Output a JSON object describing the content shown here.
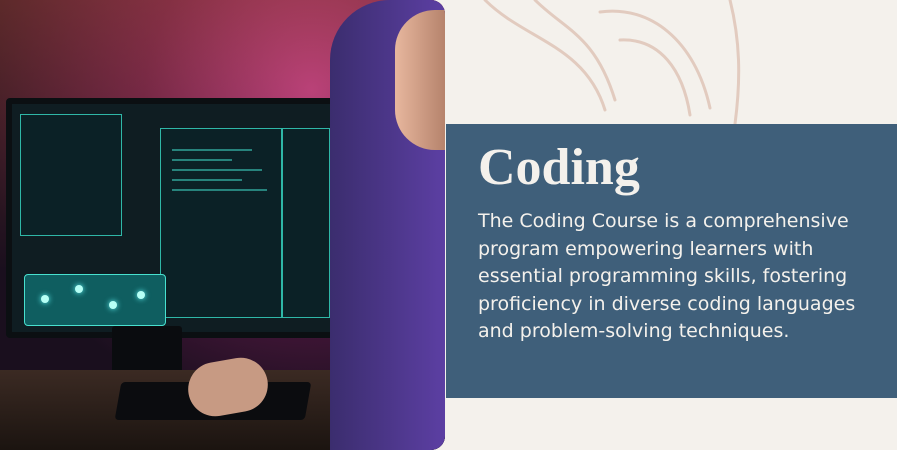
{
  "card": {
    "title": "Coding",
    "description": "The Coding Course is a comprehensive program empowering learners with essential programming skills, fostering proficiency in diverse coding languages and problem-solving techniques."
  },
  "colors": {
    "background": "#f4f1ec",
    "text_panel": "#3f5f7a",
    "text": "#f4f1ec",
    "screen_accent": "#3fd6c3"
  },
  "icons": [
    "doodle-icon"
  ]
}
